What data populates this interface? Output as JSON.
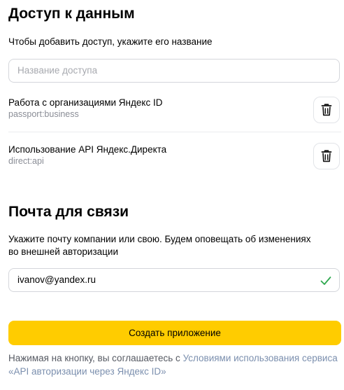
{
  "access": {
    "title": "Доступ к данным",
    "hint": "Чтобы добавить доступ, укажите его название",
    "input_placeholder": "Название доступа",
    "items": [
      {
        "title": "Работа с организациями Яндекс ID",
        "scope": "passport:business"
      },
      {
        "title": "Использование API Яндекс.Директа",
        "scope": "direct:api"
      }
    ]
  },
  "contact": {
    "title": "Почта для связи",
    "hint_line1": "Укажите почту компании или свою. Будем оповещать об изменениях",
    "hint_line2": "во внешней авторизации",
    "email_value": "ivanov@yandex.ru"
  },
  "submit_label": "Создать приложение",
  "terms": {
    "prefix": "Нажимая на кнопку, вы соглашаетесь с ",
    "link": "Условиями использования сервиса «API авторизации через Яндекс ID»"
  },
  "icons": {
    "delete": "trash-icon",
    "valid": "check-icon"
  },
  "colors": {
    "primary_button": "#ffcc00",
    "link": "#7b8fae",
    "valid_check": "#2fa84f"
  }
}
